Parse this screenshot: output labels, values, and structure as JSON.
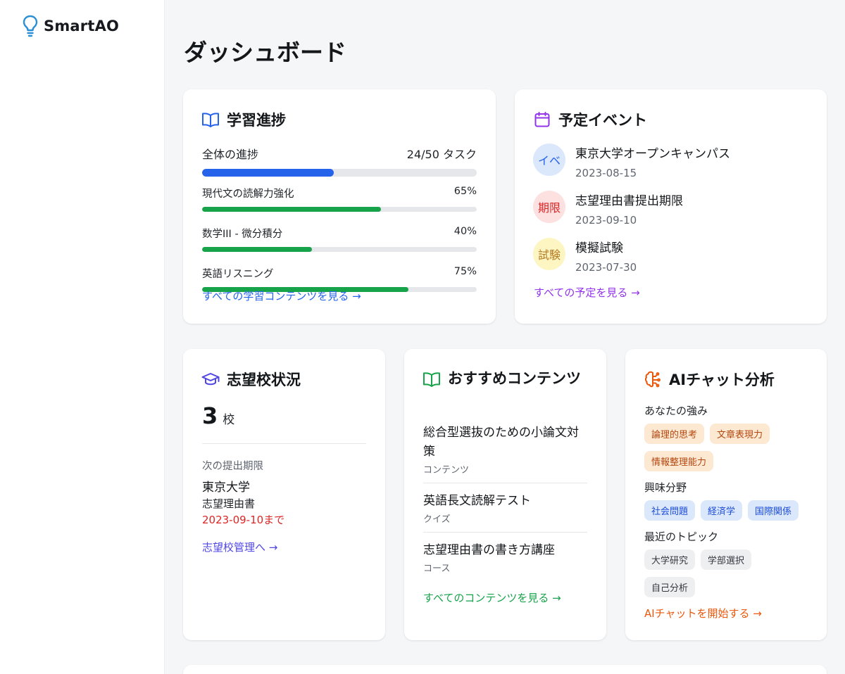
{
  "app": {
    "name": "SmartAO"
  },
  "page": {
    "title": "ダッシュボード"
  },
  "progress_card": {
    "title": "学習進捗",
    "overall_label": "全体の進捗",
    "overall_value": "24/50 タスク",
    "overall_fraction": 0.48,
    "subjects": [
      {
        "name": "現代文の読解力強化",
        "percent_label": "65%",
        "percent": 65
      },
      {
        "name": "数学III - 微分積分",
        "percent_label": "40%",
        "percent": 40
      },
      {
        "name": "英語リスニング",
        "percent_label": "75%",
        "percent": 75
      }
    ],
    "link": "すべての学習コンテンツを見る →"
  },
  "events_card": {
    "title": "予定イベント",
    "events": [
      {
        "badge": "イベ",
        "name": "東京大学オープンキャンパス",
        "date": "2023-08-15",
        "badge_bg": "#dbe7fb",
        "badge_color": "#2563eb"
      },
      {
        "badge": "期限",
        "name": "志望理由書提出期限",
        "date": "2023-09-10",
        "badge_bg": "#fde0e0",
        "badge_color": "#dc2626"
      },
      {
        "badge": "試験",
        "name": "模擬試験",
        "date": "2023-07-30",
        "badge_bg": "#fdf6c3",
        "badge_color": "#b7791f"
      }
    ],
    "link": "すべての予定を見る →"
  },
  "schools_card": {
    "title": "志望校状況",
    "count": "3",
    "count_unit": "校",
    "next_deadline_label": "次の提出期限",
    "school": "東京大学",
    "document": "志望理由書",
    "due": "2023-09-10まで",
    "link": "志望校管理へ →"
  },
  "recommend_card": {
    "title": "おすすめコンテンツ",
    "items": [
      {
        "title": "総合型選抜のための小論文対策",
        "type": "コンテンツ"
      },
      {
        "title": "英語長文読解テスト",
        "type": "クイズ"
      },
      {
        "title": "志望理由書の書き方講座",
        "type": "コース"
      }
    ],
    "link": "すべてのコンテンツを見る →"
  },
  "ai_card": {
    "title": "AIチャット分析",
    "strengths_label": "あなたの強み",
    "strengths": [
      "論理的思考",
      "文章表現力",
      "情報整理能力"
    ],
    "interests_label": "興味分野",
    "interests": [
      "社会問題",
      "経済学",
      "国際関係"
    ],
    "topics_label": "最近のトピック",
    "topics": [
      "大学研究",
      "学部選択",
      "自己分析"
    ],
    "link": "AIチャットを開始する →"
  },
  "colors": {
    "primary_blue": "#2563eb",
    "green": "#16a34a",
    "purple": "#9333ea",
    "red": "#dc2626",
    "orange": "#ea580c",
    "indigo": "#4f46e5"
  }
}
